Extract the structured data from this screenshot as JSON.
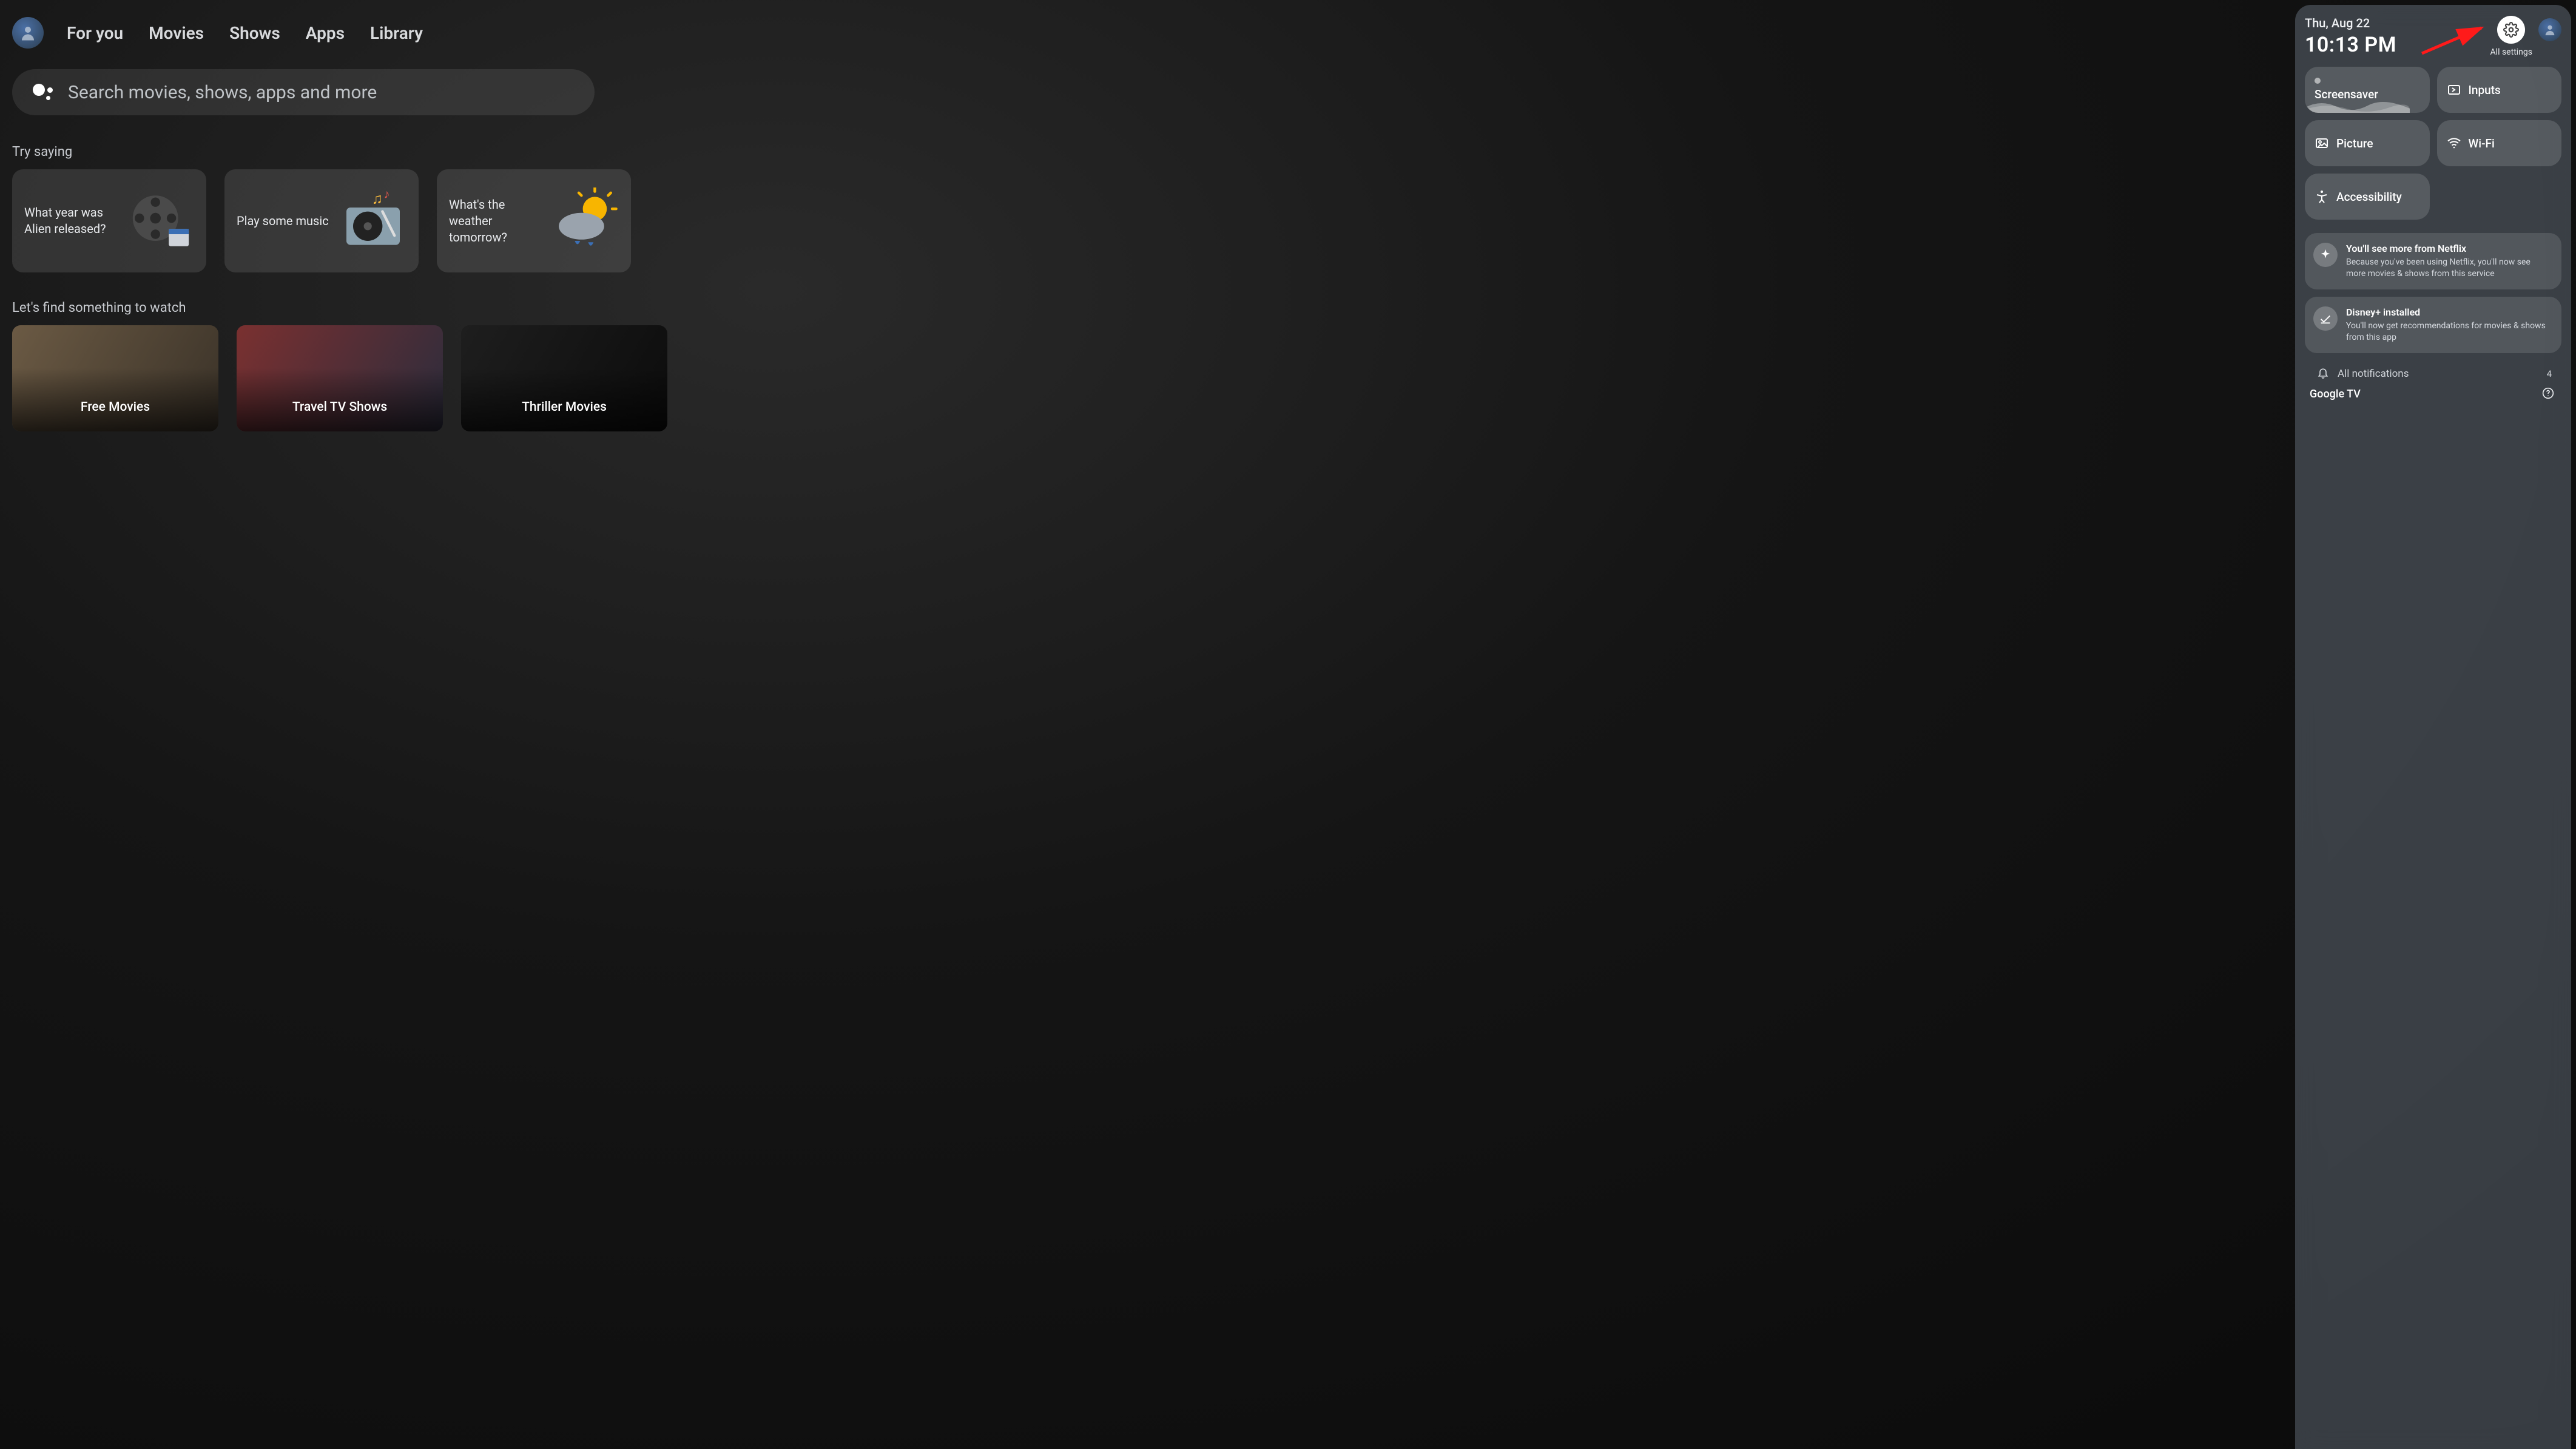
{
  "nav": {
    "tabs": [
      "For you",
      "Movies",
      "Shows",
      "Apps",
      "Library"
    ]
  },
  "search": {
    "placeholder": "Search movies, shows, apps and more"
  },
  "try_saying": {
    "title": "Try saying",
    "cards": [
      {
        "text": "What year was Alien released?",
        "icon": "film-reel"
      },
      {
        "text": "Play some music",
        "icon": "turntable"
      },
      {
        "text": "What's the weather tomorrow?",
        "icon": "weather"
      }
    ]
  },
  "watch": {
    "title": "Let's find something to watch",
    "cards": [
      "Free Movies",
      "Travel TV Shows",
      "Thriller Movies"
    ]
  },
  "panel": {
    "date": "Thu, Aug 22",
    "time": "10:13 PM",
    "all_settings_label": "All settings",
    "tiles": [
      {
        "id": "screensaver",
        "label": "Screensaver",
        "icon": "screensaver"
      },
      {
        "id": "inputs",
        "label": "Inputs",
        "icon": "input"
      },
      {
        "id": "picture",
        "label": "Picture",
        "icon": "picture"
      },
      {
        "id": "wifi",
        "label": "Wi-Fi",
        "icon": "wifi"
      },
      {
        "id": "accessibility",
        "label": "Accessibility",
        "icon": "accessibility"
      }
    ],
    "notifications": [
      {
        "icon": "sparkle",
        "title": "You'll see more from Netflix",
        "body": "Because you've been using Netflix, you'll now see more movies & shows from this service"
      },
      {
        "icon": "check",
        "title": "Disney+ installed",
        "body": "You'll now get recommendations for movies & shows from this app"
      }
    ],
    "all_notifications_label": "All notifications",
    "notification_count": "4",
    "brand": "Google TV"
  }
}
